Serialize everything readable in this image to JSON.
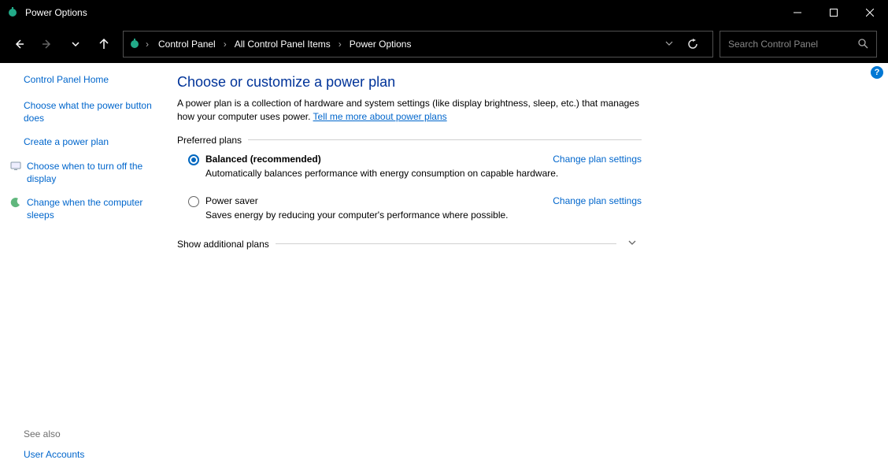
{
  "window": {
    "title": "Power Options"
  },
  "breadcrumb": {
    "items": [
      "Control Panel",
      "All Control Panel Items",
      "Power Options"
    ]
  },
  "search": {
    "placeholder": "Search Control Panel"
  },
  "sidebar": {
    "home": "Control Panel Home",
    "links": {
      "choose_button": "Choose what the power button does",
      "create_plan": "Create a power plan",
      "turn_off_display": "Choose when to turn off the display",
      "computer_sleeps": "Change when the computer sleeps"
    },
    "see_also_label": "See also",
    "user_accounts": "User Accounts"
  },
  "main": {
    "title": "Choose or customize a power plan",
    "description_prefix": "A power plan is a collection of hardware and system settings (like display brightness, sleep, etc.) that manages how your computer uses power. ",
    "description_link": "Tell me more about power plans",
    "preferred_label": "Preferred plans",
    "plans": [
      {
        "name": "Balanced (recommended)",
        "desc": "Automatically balances performance with energy consumption on capable hardware.",
        "selected": true,
        "change_link": "Change plan settings"
      },
      {
        "name": "Power saver",
        "desc": "Saves energy by reducing your computer's performance where possible.",
        "selected": false,
        "change_link": "Change plan settings"
      }
    ],
    "show_additional": "Show additional plans"
  }
}
